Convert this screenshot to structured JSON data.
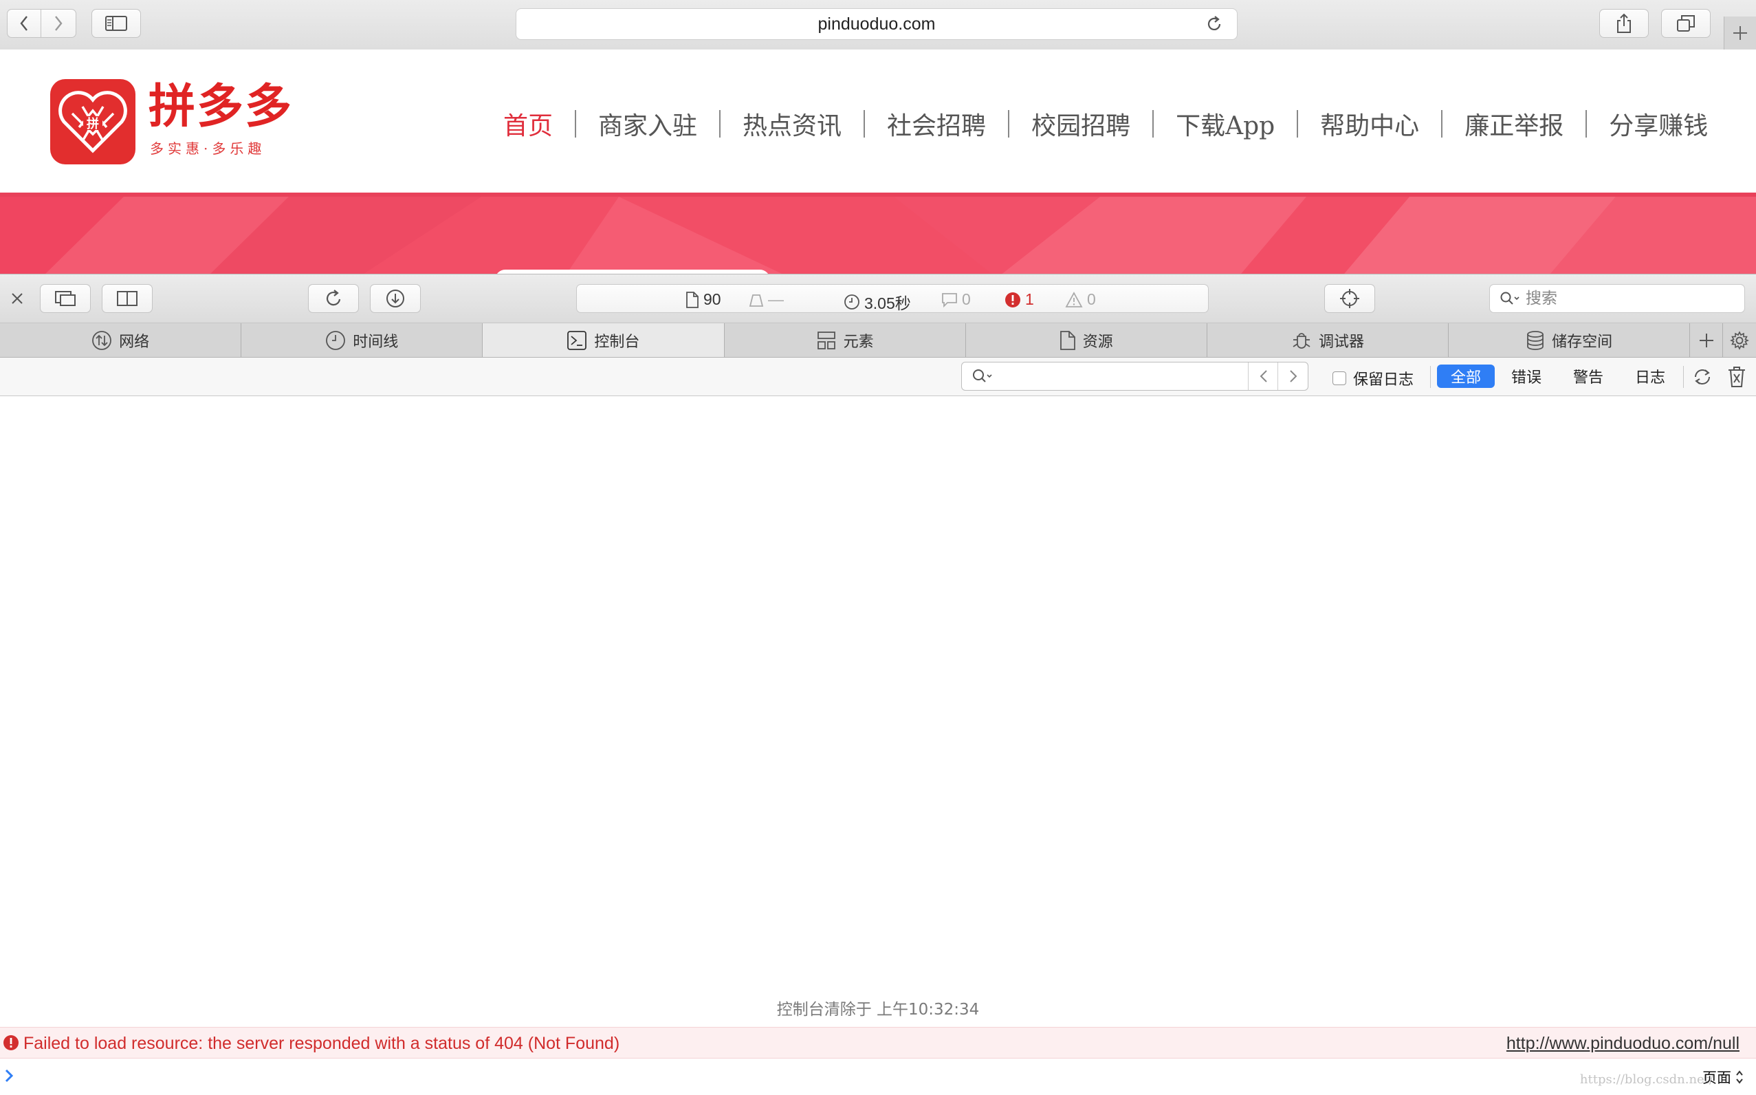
{
  "browser": {
    "url": "pinduoduo.com"
  },
  "site": {
    "brand_name": "拼多多",
    "slogan": "多实惠·多乐趣",
    "nav": [
      {
        "label": "首页",
        "active": true
      },
      {
        "label": "商家入驻",
        "active": false
      },
      {
        "label": "热点资讯",
        "active": false
      },
      {
        "label": "社会招聘",
        "active": false
      },
      {
        "label": "校园招聘",
        "active": false
      },
      {
        "label": "下载App",
        "active": false
      },
      {
        "label": "帮助中心",
        "active": false
      },
      {
        "label": "廉正举报",
        "active": false
      },
      {
        "label": "分享赚钱",
        "active": false
      }
    ],
    "colors": {
      "brand_red": "#e02424",
      "banner_pink": "#f24e66"
    }
  },
  "inspector": {
    "status": {
      "resources_count": "90",
      "size_placeholder": "—",
      "load_time": "3.05秒",
      "logs_count": "0",
      "errors_count": "1",
      "warnings_count": "0"
    },
    "search_placeholder": "搜索",
    "tabs": [
      {
        "label": "网络",
        "icon": "network-icon"
      },
      {
        "label": "时间线",
        "icon": "clock-icon"
      },
      {
        "label": "控制台",
        "icon": "console-icon",
        "active": true
      },
      {
        "label": "元素",
        "icon": "elements-icon"
      },
      {
        "label": "资源",
        "icon": "document-icon"
      },
      {
        "label": "调试器",
        "icon": "bug-icon"
      },
      {
        "label": "储存空间",
        "icon": "database-icon"
      }
    ],
    "console": {
      "preserve_log_label": "保留日志",
      "levels": [
        {
          "label": "全部",
          "active": true
        },
        {
          "label": "错误",
          "active": false
        },
        {
          "label": "警告",
          "active": false
        },
        {
          "label": "日志",
          "active": false
        }
      ],
      "cleared_text": "控制台清除于 上午10:32:34",
      "error_message": "Failed to load resource: the server responded with a status of 404 (Not Found)",
      "error_url": "http://www.pinduoduo.com/null",
      "context_label": "页面",
      "watermark": "https://blog.csdn.net/"
    }
  }
}
